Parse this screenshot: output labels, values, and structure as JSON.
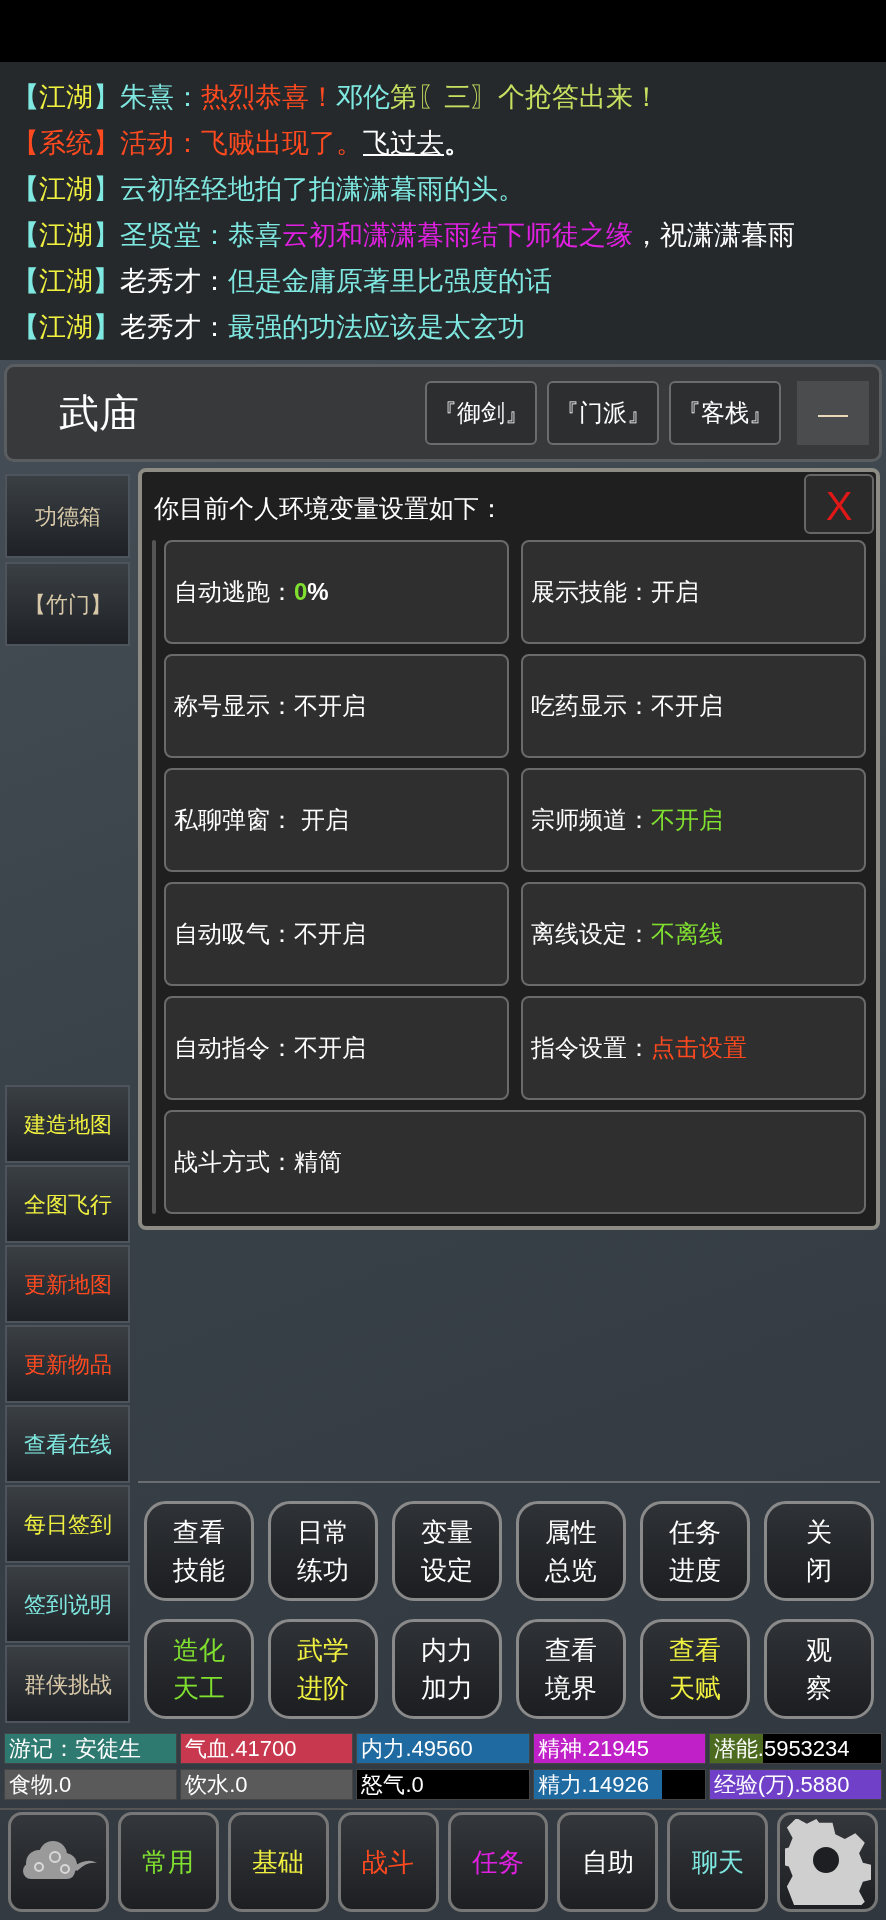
{
  "chat": [
    {
      "segments": [
        {
          "text": "【",
          "color": "#7fe8e0"
        },
        {
          "text": "江湖",
          "color": "#f0f040"
        },
        {
          "text": "】朱熹：",
          "color": "#7fe8e0"
        },
        {
          "text": "热烈恭喜！",
          "color": "#ff4a20"
        },
        {
          "text": "邓伦",
          "color": "#7fe8e0"
        },
        {
          "text": "第〖三〗个抢答出来！",
          "color": "#c8e060"
        }
      ]
    },
    {
      "segments": [
        {
          "text": "【系统】活动：飞贼出现了。",
          "color": "#ff4a20"
        },
        {
          "text": "飞过去",
          "color": "#ffffff",
          "kind": "link"
        },
        {
          "text": "。",
          "color": "#ffffff"
        }
      ]
    },
    {
      "segments": [
        {
          "text": "【",
          "color": "#7fe8e0"
        },
        {
          "text": "江湖",
          "color": "#f0f040"
        },
        {
          "text": "】云初轻轻地拍了拍潇潇暮雨的头。",
          "color": "#7fe8e0"
        }
      ]
    },
    {
      "segments": [
        {
          "text": "【",
          "color": "#7fe8e0"
        },
        {
          "text": "江湖",
          "color": "#f0f040"
        },
        {
          "text": "】圣贤堂：恭喜",
          "color": "#7fe8e0"
        },
        {
          "text": "云初和潇潇暮雨结下师徒之缘",
          "color": "#e020e0"
        },
        {
          "text": "，祝潇潇暮雨",
          "color": "#ffffff"
        }
      ]
    },
    {
      "segments": [
        {
          "text": "【",
          "color": "#7fe8e0"
        },
        {
          "text": "江湖",
          "color": "#f0f040"
        },
        {
          "text": "】",
          "color": "#7fe8e0"
        },
        {
          "text": "老秀才：",
          "color": "#ffffff"
        },
        {
          "text": "但是金庸原著里比强度的话",
          "color": "#7fe8e0"
        }
      ]
    },
    {
      "segments": [
        {
          "text": "【",
          "color": "#7fe8e0"
        },
        {
          "text": "江湖",
          "color": "#f0f040"
        },
        {
          "text": "】",
          "color": "#7fe8e0"
        },
        {
          "text": "老秀才：",
          "color": "#ffffff"
        },
        {
          "text": "最强的功法应该是太玄功",
          "color": "#7fe8e0"
        }
      ]
    }
  ],
  "location": {
    "title": "武庙",
    "exits": [
      "『御剑』",
      "『门派』",
      "『客栈』"
    ],
    "collapse": "—"
  },
  "sidebar_top": [
    {
      "label": "功德箱",
      "color": "#d8c8a8"
    },
    {
      "label": "【竹门】",
      "color": "#d8c8a8"
    }
  ],
  "sidebar_bottom": [
    {
      "label": "建造地图",
      "color": "#f0f040"
    },
    {
      "label": "全图飞行",
      "color": "#f0f040"
    },
    {
      "label": "更新地图",
      "color": "#ff4a20"
    },
    {
      "label": "更新物品",
      "color": "#ff4a20"
    },
    {
      "label": "查看在线",
      "color": "#7fe8e0"
    },
    {
      "label": "每日签到",
      "color": "#f0f040"
    },
    {
      "label": "签到说明",
      "color": "#7fe8e0"
    },
    {
      "label": "群侠挑战",
      "color": "#d8c8a8"
    }
  ],
  "settings": {
    "title": "你目前个人环境变量设置如下：",
    "close": "X",
    "items": [
      {
        "segments": [
          {
            "text": "自动逃跑：",
            "color": "#ffffff"
          },
          {
            "text": "0",
            "color": "#80e030"
          },
          {
            "text": "%",
            "color": "#ffffff"
          }
        ]
      },
      {
        "segments": [
          {
            "text": "展示技能：开启",
            "color": "#ffffff"
          }
        ]
      },
      {
        "segments": [
          {
            "text": "称号显示：不开启",
            "color": "#ffffff"
          }
        ]
      },
      {
        "segments": [
          {
            "text": "吃药显示：不开启",
            "color": "#ffffff"
          }
        ]
      },
      {
        "segments": [
          {
            "text": "私聊弹窗： 开启",
            "color": "#ffffff"
          }
        ]
      },
      {
        "segments": [
          {
            "text": "宗师频道：",
            "color": "#ffffff"
          },
          {
            "text": "不开启",
            "color": "#80e030"
          }
        ]
      },
      {
        "segments": [
          {
            "text": "自动吸气：不开启",
            "color": "#ffffff"
          }
        ]
      },
      {
        "segments": [
          {
            "text": "离线设定：",
            "color": "#ffffff"
          },
          {
            "text": "不离线",
            "color": "#80e030"
          }
        ]
      },
      {
        "segments": [
          {
            "text": "自动指令：不开启",
            "color": "#ffffff"
          }
        ]
      },
      {
        "segments": [
          {
            "text": "指令设置：",
            "color": "#ffffff"
          },
          {
            "text": "点击设置",
            "color": "#ff4a20"
          }
        ]
      },
      {
        "segments": [
          {
            "text": "战斗方式：精简",
            "color": "#ffffff"
          }
        ],
        "wide": true
      }
    ]
  },
  "actions": [
    {
      "label": "查看技能",
      "color": "#ffffff"
    },
    {
      "label": "日常练功",
      "color": "#ffffff"
    },
    {
      "label": "变量设定",
      "color": "#ffffff"
    },
    {
      "label": "属性总览",
      "color": "#ffffff"
    },
    {
      "label": "任务进度",
      "color": "#ffffff"
    },
    {
      "label": "关闭",
      "color": "#ffffff"
    },
    {
      "label": "造化天工",
      "color": "#80e030"
    },
    {
      "label": "武学进阶",
      "color": "#f0f040"
    },
    {
      "label": "内力加力",
      "color": "#ffffff"
    },
    {
      "label": "查看境界",
      "color": "#ffffff"
    },
    {
      "label": "查看天赋",
      "color": "#f0f040"
    },
    {
      "label": "观察",
      "color": "#ffffff"
    }
  ],
  "stats": [
    {
      "kind": "tag",
      "label": "游记：安徒生",
      "color": "#2f7a70"
    },
    {
      "kind": "meter",
      "label": "气血.41700",
      "color": "#c8384e",
      "level": 1
    },
    {
      "kind": "meter",
      "label": "内力.49560",
      "color": "#1f6aa0",
      "level": 1
    },
    {
      "kind": "meter",
      "label": "精神.21945",
      "color": "#c020c8",
      "level": 1
    },
    {
      "kind": "meter",
      "label": "潜能.5953234",
      "color": "#4c6a20",
      "level": 0.31
    },
    {
      "kind": "meter",
      "label": "食物.0",
      "color": "#5a5a5a",
      "level": 1
    },
    {
      "kind": "meter",
      "label": "饮水.0",
      "color": "#5a5a5a",
      "level": 1
    },
    {
      "kind": "empty",
      "label": "怒气.0"
    },
    {
      "kind": "meter",
      "label": "精力.14926",
      "color": "#1f6aa0",
      "level": 0.75
    },
    {
      "kind": "meter",
      "label": "经验(万).5880",
      "color": "#7040c8",
      "level": 1
    }
  ],
  "nav": [
    {
      "kind": "cloud"
    },
    {
      "kind": "text",
      "label": "常用",
      "color": "#80e030"
    },
    {
      "kind": "text",
      "label": "基础",
      "color": "#f0f040"
    },
    {
      "kind": "text",
      "label": "战斗",
      "color": "#ff4a20"
    },
    {
      "kind": "text",
      "label": "任务",
      "color": "#e020e0"
    },
    {
      "kind": "text",
      "label": "自助",
      "color": "#ffffff"
    },
    {
      "kind": "text",
      "label": "聊天",
      "color": "#7fe8e0"
    },
    {
      "kind": "gear"
    }
  ]
}
